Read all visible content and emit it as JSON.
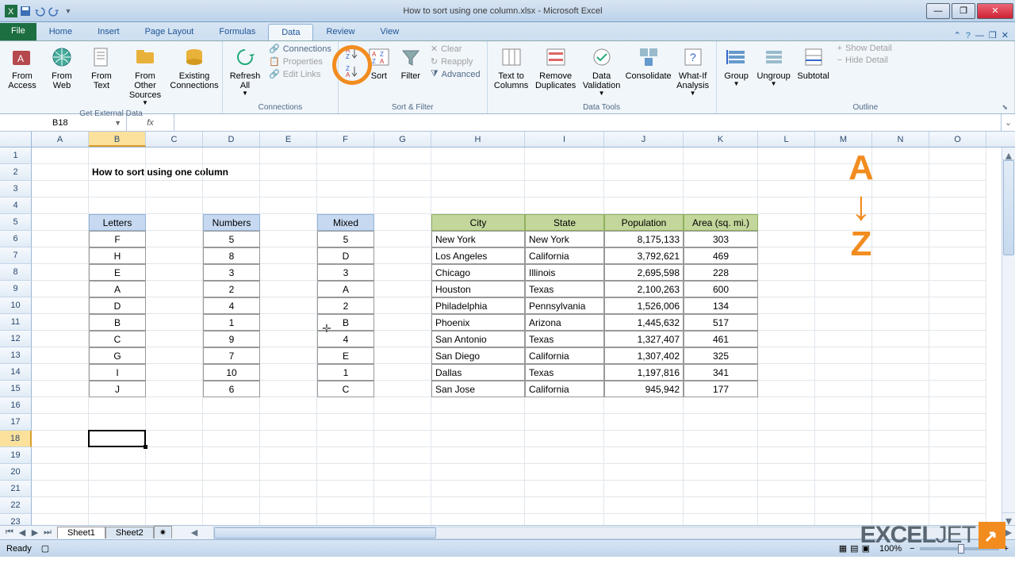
{
  "window": {
    "title": "How to sort using one column.xlsx - Microsoft Excel"
  },
  "tabs": {
    "file": "File",
    "items": [
      "Home",
      "Insert",
      "Page Layout",
      "Formulas",
      "Data",
      "Review",
      "View"
    ],
    "active": "Data"
  },
  "ribbon": {
    "groups": {
      "external": {
        "label": "Get External Data",
        "from_access": "From Access",
        "from_web": "From Web",
        "from_text": "From Text",
        "from_other": "From Other Sources",
        "existing": "Existing Connections"
      },
      "connections": {
        "label": "Connections",
        "refresh": "Refresh All",
        "connections": "Connections",
        "properties": "Properties",
        "edit_links": "Edit Links"
      },
      "sortfilter": {
        "label": "Sort & Filter",
        "sort": "Sort",
        "filter": "Filter",
        "clear": "Clear",
        "reapply": "Reapply",
        "advanced": "Advanced"
      },
      "datatools": {
        "label": "Data Tools",
        "ttc": "Text to Columns",
        "rdup": "Remove Duplicates",
        "dval": "Data Validation",
        "consol": "Consolidate",
        "whatif": "What-If Analysis"
      },
      "outline": {
        "label": "Outline",
        "group": "Group",
        "ungroup": "Ungroup",
        "subtotal": "Subtotal",
        "show": "Show Detail",
        "hide": "Hide Detail"
      }
    }
  },
  "namebox": "B18",
  "formula": "",
  "columns": [
    "A",
    "B",
    "C",
    "D",
    "E",
    "F",
    "G",
    "H",
    "I",
    "J",
    "K",
    "L",
    "M",
    "N",
    "O"
  ],
  "sel_col": "B",
  "sel_row": 18,
  "sheet": {
    "title_cell": "How to sort using one column",
    "letters_h": "Letters",
    "numbers_h": "Numbers",
    "mixed_h": "Mixed",
    "city_h": "City",
    "state_h": "State",
    "pop_h": "Population",
    "area_h": "Area (sq. mi.)",
    "letters": [
      "F",
      "H",
      "E",
      "A",
      "D",
      "B",
      "C",
      "G",
      "I",
      "J"
    ],
    "numbers": [
      "5",
      "8",
      "3",
      "2",
      "4",
      "1",
      "9",
      "7",
      "10",
      "6"
    ],
    "mixed": [
      "5",
      "D",
      "3",
      "A",
      "2",
      "B",
      "4",
      "E",
      "1",
      "C"
    ],
    "cities": [
      {
        "city": "New York",
        "state": "New York",
        "pop": "8,175,133",
        "area": "303"
      },
      {
        "city": "Los Angeles",
        "state": "California",
        "pop": "3,792,621",
        "area": "469"
      },
      {
        "city": "Chicago",
        "state": "Illinois",
        "pop": "2,695,598",
        "area": "228"
      },
      {
        "city": "Houston",
        "state": "Texas",
        "pop": "2,100,263",
        "area": "600"
      },
      {
        "city": "Philadelphia",
        "state": "Pennsylvania",
        "pop": "1,526,006",
        "area": "134"
      },
      {
        "city": "Phoenix",
        "state": "Arizona",
        "pop": "1,445,632",
        "area": "517"
      },
      {
        "city": "San Antonio",
        "state": "Texas",
        "pop": "1,327,407",
        "area": "461"
      },
      {
        "city": "San Diego",
        "state": "California",
        "pop": "1,307,402",
        "area": "325"
      },
      {
        "city": "Dallas",
        "state": "Texas",
        "pop": "1,197,816",
        "area": "341"
      },
      {
        "city": "San Jose",
        "state": "California",
        "pop": "945,942",
        "area": "177"
      }
    ]
  },
  "az": {
    "a": "A",
    "z": "Z",
    "arrow": "↓"
  },
  "sheets": {
    "s1": "Sheet1",
    "s2": "Sheet2"
  },
  "status": {
    "ready": "Ready",
    "zoom": "100%"
  },
  "watermark": {
    "excel": "EXCEL",
    "jet": "JET"
  }
}
